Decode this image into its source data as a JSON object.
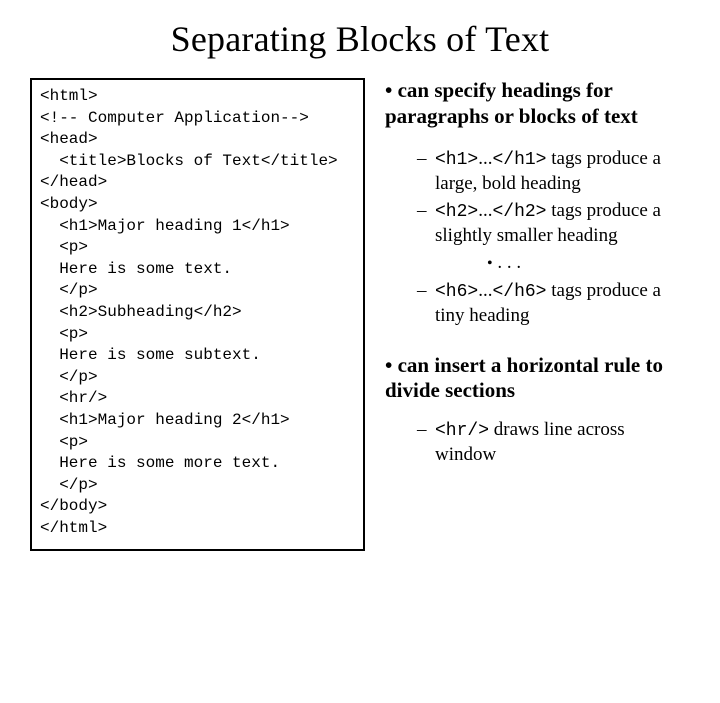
{
  "title": "Separating Blocks of Text",
  "code": {
    "l1": "<html>",
    "l2": "<!-- Computer Application-->",
    "l3": "<head>",
    "l4": "  <title>Blocks of Text</title>",
    "l5": "</head>",
    "l6": "",
    "l7": "<body>",
    "l8": "  <h1>Major heading 1</h1>",
    "l9": "  <p>",
    "l10": "  Here is some text.",
    "l11": "  </p>",
    "l12": "",
    "l13": "  <h2>Subheading</h2>",
    "l14": "  <p>",
    "l15": "  Here is some subtext.",
    "l16": "  </p>",
    "l17": "",
    "l18": "  <hr/>",
    "l19": "",
    "l20": "  <h1>Major heading 2</h1>",
    "l21": "  <p>",
    "l22": "  Here is some more text.",
    "l23": "  </p>",
    "l24": "</body>",
    "l25": "",
    "l26": "</html>"
  },
  "right": {
    "headings_bullet": "• can specify headings for paragraphs or blocks of text",
    "sub1_code": "<h1>",
    "sub1_mid": "...",
    "sub1_code2": "</h1>",
    "sub1_tail": " tags produce a large, bold heading",
    "sub2_code": "<h2>",
    "sub2_mid": "...",
    "sub2_code2": "</h2>",
    "sub2_tail": " tags produce a slightly smaller heading",
    "dots": ". . .",
    "sub3_code": "<h6>",
    "sub3_mid": "...",
    "sub3_code2": "</h6>",
    "sub3_tail": " tags produce a tiny heading",
    "hr_bullet": "• can insert a horizontal rule to divide sections",
    "hr_sub_code": "<hr/>",
    "hr_sub_tail": " draws line across window"
  }
}
